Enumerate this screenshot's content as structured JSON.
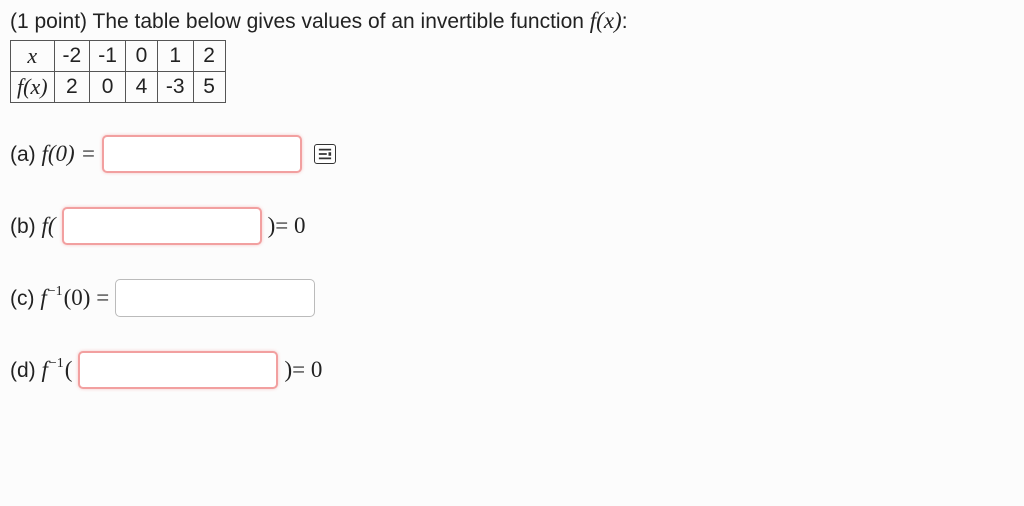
{
  "prompt": {
    "points_prefix": "(1 point) ",
    "text": "The table below gives values of an invertible function ",
    "func": "f(x)",
    "colon": ":"
  },
  "table": {
    "row_x_label": "x",
    "row_x": [
      "-2",
      "-1",
      "0",
      "1",
      "2"
    ],
    "row_fx_label": "f(x)",
    "row_fx": [
      "2",
      "0",
      "4",
      "-3",
      "5"
    ]
  },
  "parts": {
    "a": {
      "label": "(a) ",
      "expr": "f(0) ="
    },
    "b": {
      "label": "(b) ",
      "expr_pre": "f(",
      "expr_post": ")= 0"
    },
    "c": {
      "label": "(c) ",
      "expr_f": "f",
      "expr_exp": "−1",
      "expr_arg": "(0) ="
    },
    "d": {
      "label": "(d) ",
      "expr_f": "f",
      "expr_exp": "−1",
      "expr_pre": "(",
      "expr_post": ")= 0"
    }
  }
}
